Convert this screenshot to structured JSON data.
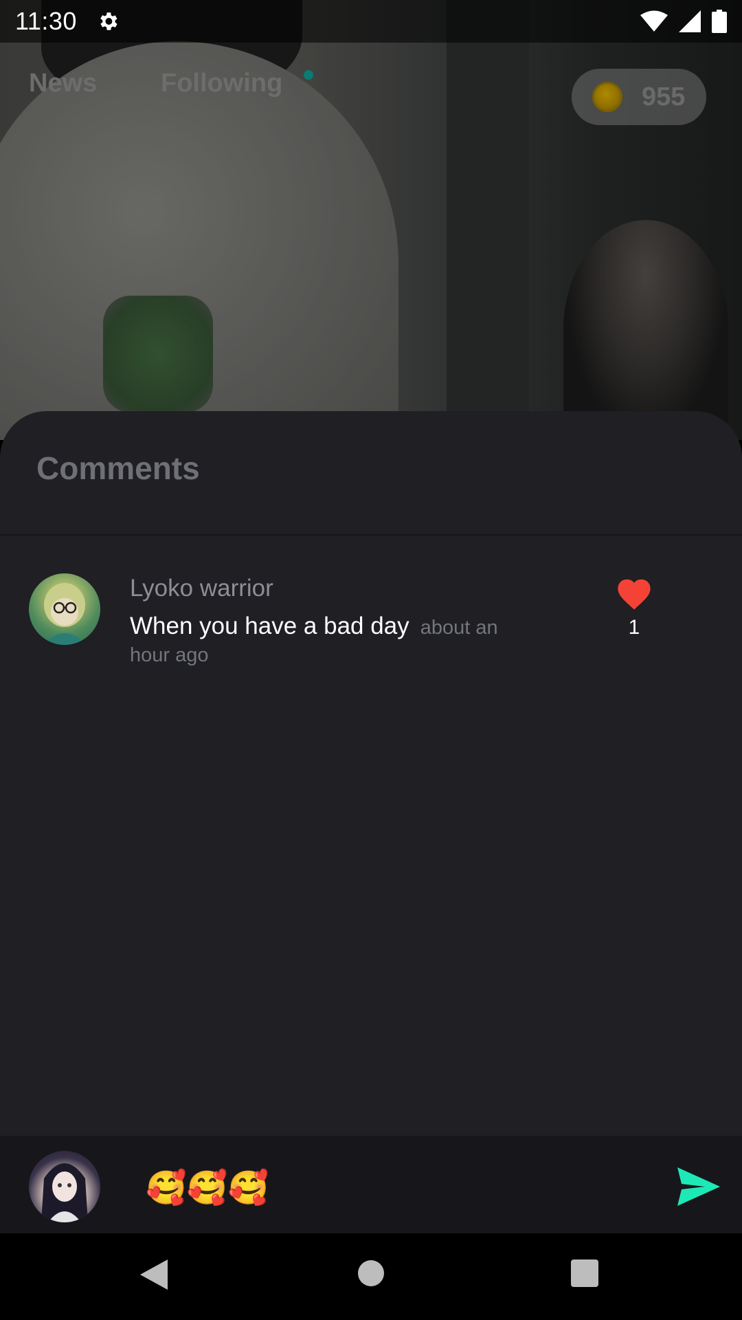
{
  "status_bar": {
    "time": "11:30",
    "icons": [
      "gear-icon",
      "wifi-icon",
      "cellular-icon",
      "battery-icon"
    ]
  },
  "top_nav": {
    "tabs": [
      {
        "label": "News"
      },
      {
        "label": "Following"
      }
    ],
    "coins": "955"
  },
  "comments": {
    "title": "Comments",
    "items": [
      {
        "author": "Lyoko warrior",
        "text": "When you have a bad day",
        "time": "about an hour ago",
        "likes": "1"
      }
    ]
  },
  "input": {
    "value": "🥰🥰🥰"
  },
  "colors": {
    "sheet_bg": "#1f1f24",
    "like": "#f44336",
    "send": "#1de9b6",
    "coin": "#b08a00"
  }
}
